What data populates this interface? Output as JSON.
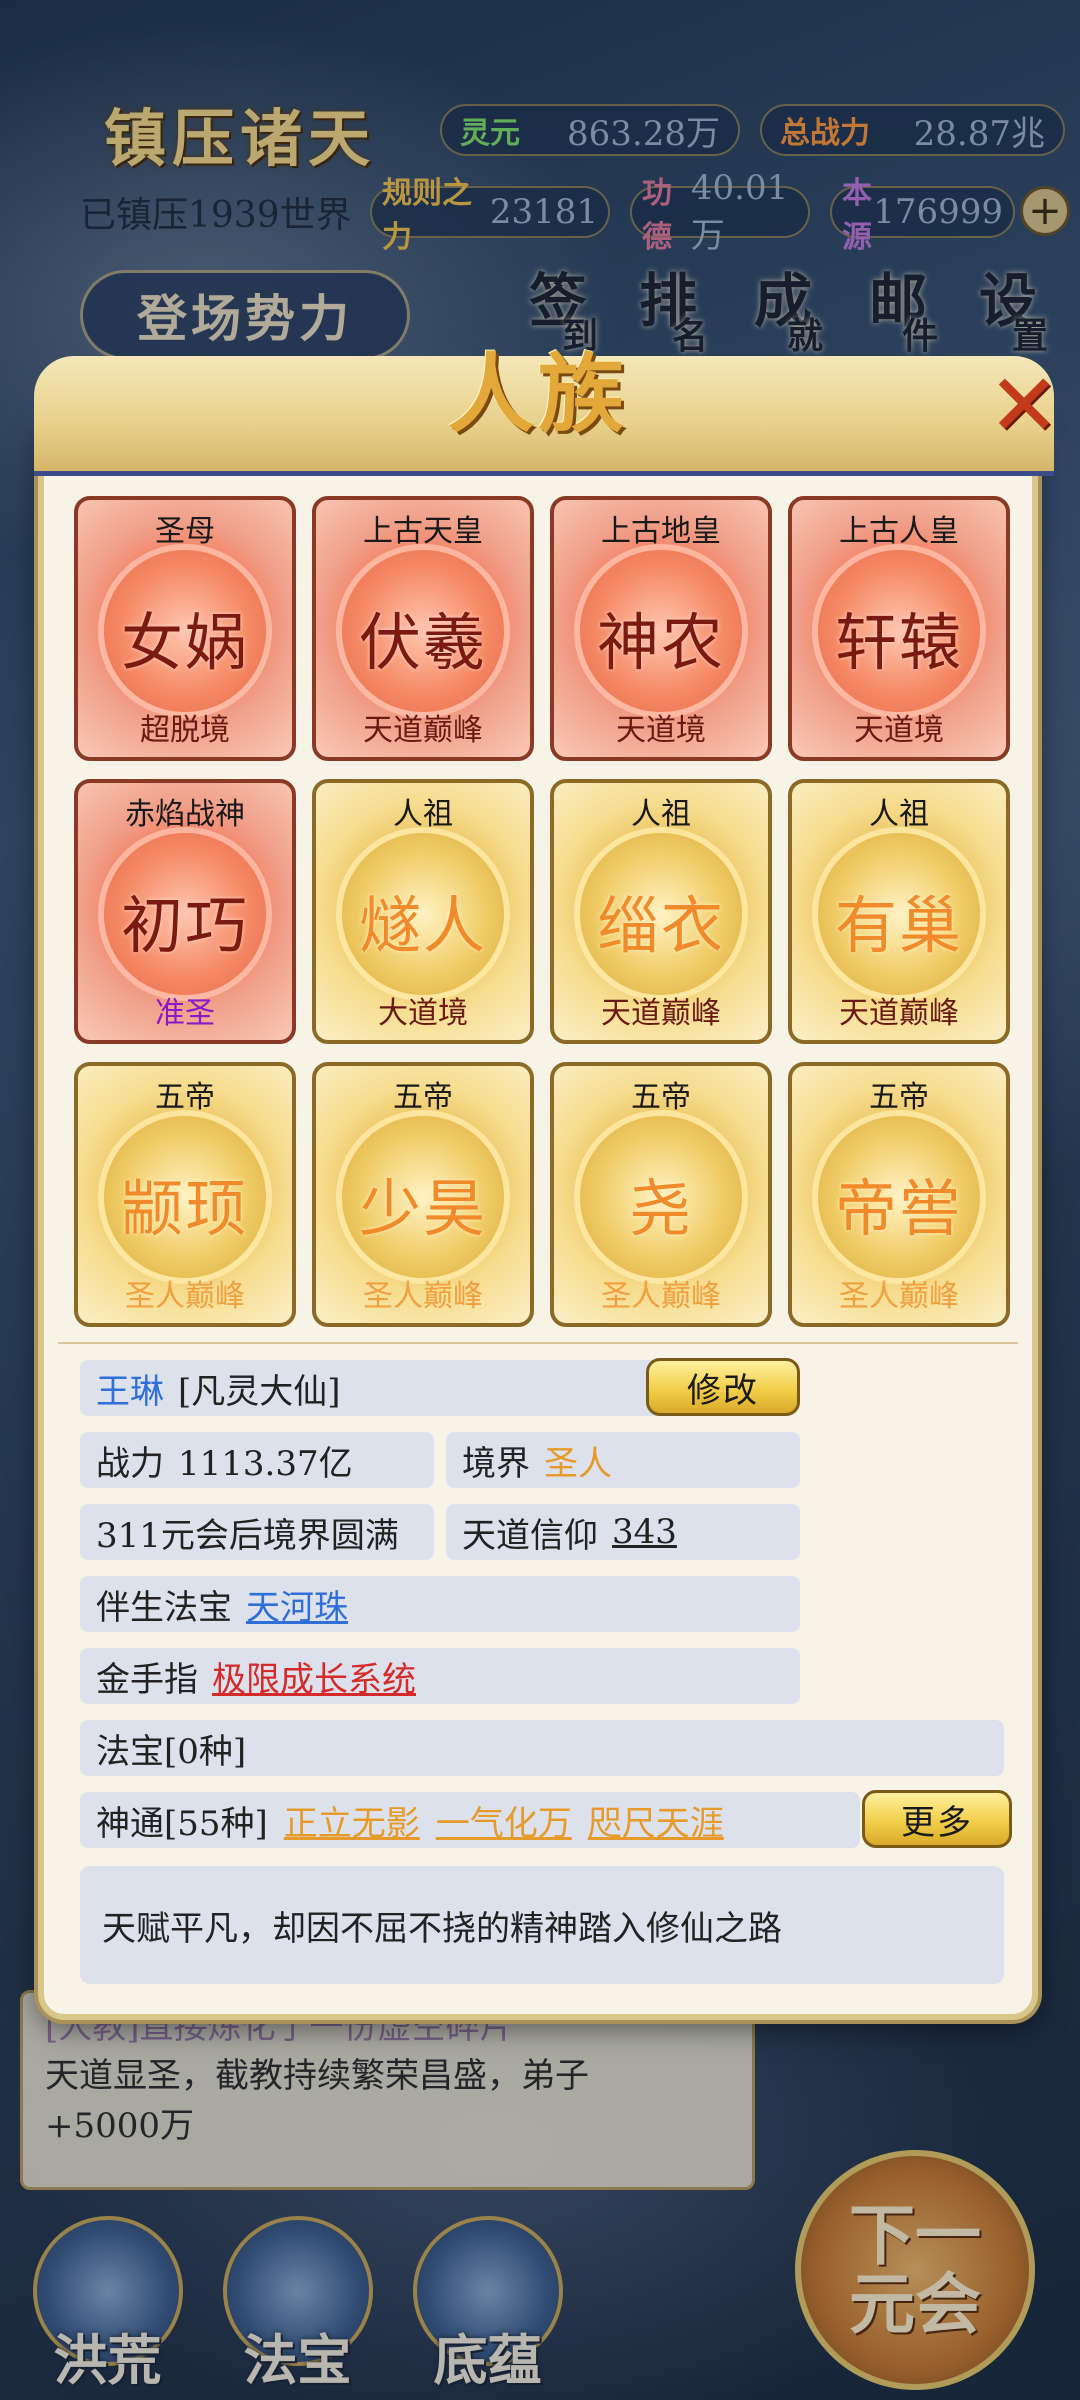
{
  "hud": {
    "game_title": "镇压诸天",
    "suppressed_text": "已镇压1939世界",
    "stats": {
      "lingyuan_label": "灵元",
      "lingyuan_value": "863.28万",
      "power_label": "总战力",
      "power_value": "28.87兆",
      "rules_label": "规则之力",
      "rules_value": "23181",
      "merit_label": "功德",
      "merit_value": "40.01万",
      "origin_label": "本源",
      "origin_value": "176999"
    },
    "plus": "+",
    "forces_button": "登场势力",
    "menu": {
      "signin_a": "签",
      "signin_b": "到",
      "rank_a": "排",
      "rank_b": "名",
      "achieve_a": "成",
      "achieve_b": "就",
      "mail_a": "邮",
      "mail_b": "件",
      "settings_a": "设",
      "settings_b": "置"
    }
  },
  "background_log": {
    "line1": "[人教]直接炼化了一份虚空碎片",
    "line2": "天道显圣，截教持续繁荣昌盛，弟子",
    "line3": "+5000万"
  },
  "next_era": {
    "line1": "下一",
    "line2": "元会"
  },
  "bottom_nav": [
    "洪荒",
    "法宝",
    "底蕴"
  ],
  "modal": {
    "title": "人族",
    "close": "✕",
    "cards": [
      {
        "title": "圣母",
        "name": "女娲",
        "realm": "超脱境",
        "style": "red"
      },
      {
        "title": "上古天皇",
        "name": "伏羲",
        "realm": "天道巅峰",
        "style": "red"
      },
      {
        "title": "上古地皇",
        "name": "神农",
        "realm": "天道境",
        "style": "red"
      },
      {
        "title": "上古人皇",
        "name": "轩辕",
        "realm": "天道境",
        "style": "red"
      },
      {
        "title": "赤焰战神",
        "name": "初巧",
        "realm": "准圣",
        "style": "red",
        "realm_color": "purple"
      },
      {
        "title": "人祖",
        "name": "燧人",
        "realm": "大道境",
        "style": "gold"
      },
      {
        "title": "人祖",
        "name": "缁衣",
        "realm": "天道巅峰",
        "style": "gold"
      },
      {
        "title": "人祖",
        "name": "有巢",
        "realm": "天道巅峰",
        "style": "gold"
      },
      {
        "title": "五帝",
        "name": "颛顼",
        "realm": "圣人巅峰",
        "style": "gold",
        "realm_color": "faint"
      },
      {
        "title": "五帝",
        "name": "少昊",
        "realm": "圣人巅峰",
        "style": "gold",
        "realm_color": "faint"
      },
      {
        "title": "五帝",
        "name": "尧",
        "realm": "圣人巅峰",
        "style": "gold",
        "realm_color": "faint"
      },
      {
        "title": "五帝",
        "name": "帝喾",
        "realm": "圣人巅峰",
        "style": "gold",
        "realm_color": "faint"
      }
    ],
    "info": {
      "name": "王琳",
      "rank": "[凡灵大仙]",
      "edit_button": "修改",
      "power_label": "战力",
      "power_value": "1113.37亿",
      "realm_label": "境界",
      "realm_value": "圣人",
      "countdown": "311元会后境界圆满",
      "faith_label": "天道信仰",
      "faith_value": "343",
      "treasure_label": "伴生法宝",
      "treasure_value": "天河珠",
      "finger_label": "金手指",
      "finger_value": "极限成长系统",
      "magic_items": "法宝[0种]",
      "skills_label": "神通[55种]",
      "skills": [
        "正立无影",
        "一气化万",
        "咫尺天涯"
      ],
      "more_button": "更多",
      "description": "天赋平凡，却因不屈不挠的精神踏入修仙之路"
    }
  },
  "colors": {
    "accent_gold": "#f2cf4a",
    "link_blue": "#2f6fd8",
    "link_red": "#d42a2a",
    "link_orange": "#e59a2a"
  }
}
